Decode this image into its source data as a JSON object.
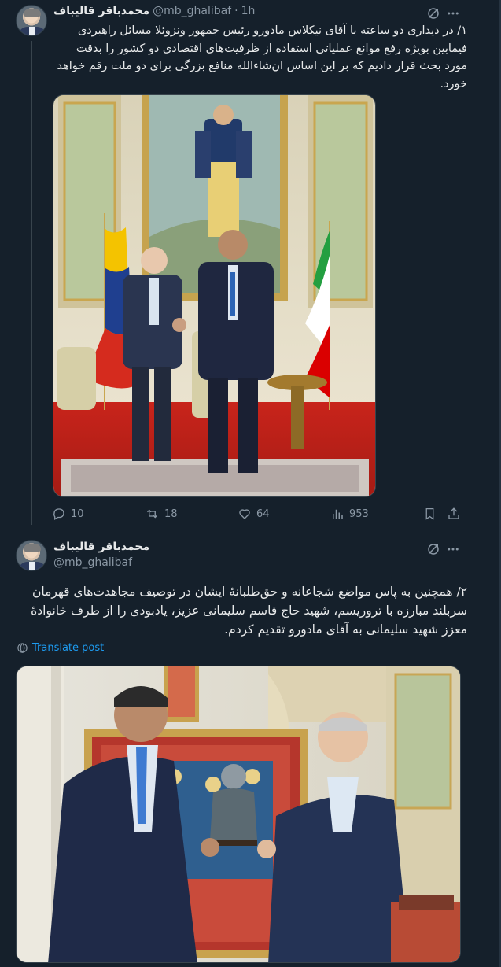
{
  "tweet1": {
    "name": "محمدباقر قالیباف",
    "handle": "@mb_ghalibaf",
    "separator": "·",
    "time": "1h",
    "text": "۱/ در دیداری دو ساعته با آقای نیکلاس مادورو رئیس جمهور ونزوئلا مسائل راهبردی فیمابین بویژه رفع موانع عملیاتی استفاده از ظرفیت‌های اقتصادی دو کشور را بدقت مورد بحث قرار دادیم که بر این اساس ان‌شاءالله منافع بزرگی برای دو ملت رقم خواهد خورد.",
    "media_alt": "Handshake between Ghalibaf and Maduro beside Venezuelan and Iranian flags under a portrait of Simón Bolívar",
    "stats": {
      "replies": "10",
      "retweets": "18",
      "likes": "64",
      "views": "953"
    }
  },
  "tweet2": {
    "name": "محمدباقر قالیباف",
    "handle": "@mb_ghalibaf",
    "text": "۲/ همچنین به پاس مواضع شجاعانه و حق‌طلبانهٔ ایشان در توصیف مجاهدت‌های قهرمان سربلند مبارزه با تروریسم، شهید حاج قاسم سلیمانی عزیز، یادبودی را از طرف خانوادهٔ معزز شهید سلیمانی به آقای مادورو تقدیم کردم.",
    "translate_label": "Translate post",
    "media_alt": "Ghalibaf presenting a Soleimani bust to Maduro in front of a carpet"
  },
  "icons": {
    "grok": "grok-icon",
    "more": "more-icon",
    "reply": "reply-icon",
    "retweet": "retweet-icon",
    "like": "heart-icon",
    "views": "views-icon",
    "bookmark": "bookmark-icon",
    "share": "share-icon",
    "translate": "globe-icon"
  },
  "colors": {
    "background": "#15202b",
    "text": "#e7e9ea",
    "muted": "#8b98a5",
    "accent": "#1d9bf0",
    "border": "#38444d"
  }
}
